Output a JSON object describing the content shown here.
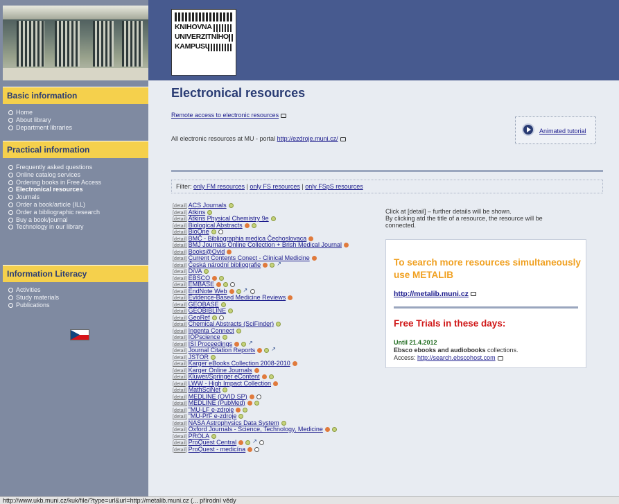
{
  "logo": {
    "line1": "KNIHOVNA",
    "line2": "UNIVERZITNÍHO",
    "line3": "KAMPUSU"
  },
  "sidebar": {
    "sections": [
      {
        "title": "Basic information",
        "items": [
          "Home",
          "About library",
          "Department libraries"
        ]
      },
      {
        "title": "Practical information",
        "items": [
          "Frequently asked questions",
          "Online catalog services",
          "Ordering books in Free Access",
          "Electronical resources",
          "Journals",
          "Order a book/article (ILL)",
          "Order a bibliographic research",
          "Buy a book/journal",
          "Technology in our library"
        ]
      },
      {
        "title": "Information Literacy",
        "items": [
          "Activities",
          "Study materials",
          "Publications"
        ]
      }
    ]
  },
  "main": {
    "title": "Electronical resources",
    "remote_link": "Remote access to electronic resources",
    "all_text": "All electronic resources at MU - portal ",
    "all_link": "http://ezdroje.muni.cz/",
    "tutorial": "Animated tutorial",
    "filter_label": "Filter: ",
    "filters": [
      "only FM resources",
      "only FS resources",
      "only FSpS resources"
    ],
    "filter_sep": " | ",
    "detail_label": "[detail]",
    "note_line1": "Click at [detail] – further details will be shown.",
    "note_line2": "By clicking atd the title of a resource, the resource will be connected.",
    "metalib_heading": "To search more resources simultaneously use METALIB",
    "metalib_link": "http://metalib.muni.cz",
    "trials_heading": "Free Trials in these days:",
    "until": "Until 21.4.2012",
    "ebsco_bold": "Ebsco ebooks and audiobooks",
    "ebsco_rest": " collections.",
    "access_label": "Access: ",
    "access_link": "http://search.ebscohost.com"
  },
  "resources": [
    {
      "name": "ACS Journals",
      "icons": [
        "y"
      ]
    },
    {
      "name": "Atkins",
      "icons": [
        "y"
      ]
    },
    {
      "name": "Atkins Physical Chemistry 9e",
      "icons": [
        "y"
      ]
    },
    {
      "name": "Biological Abstracts",
      "icons": [
        "s",
        "y"
      ]
    },
    {
      "name": "BioOne",
      "icons": [
        "y",
        "c"
      ]
    },
    {
      "name": "BMČ - Bibliographia medica Čechoslovaca",
      "icons": [
        "s"
      ]
    },
    {
      "name": "BMJ Journals Online Collection + Brish Medical Journal",
      "icons": [
        "s"
      ]
    },
    {
      "name": "Books@Ovid",
      "icons": [
        "s"
      ]
    },
    {
      "name": "Current Contents Conect - Clinical Medicine",
      "icons": [
        "s"
      ]
    },
    {
      "name": "Česká národní bibliografie",
      "icons": [
        "s",
        "y",
        "a"
      ]
    },
    {
      "name": "DiVA",
      "icons": [
        "y"
      ]
    },
    {
      "name": "EBSCO",
      "icons": [
        "s",
        "y"
      ]
    },
    {
      "name": "EMBASE",
      "icons": [
        "s",
        "y",
        "c"
      ]
    },
    {
      "name": "EndNote Web",
      "icons": [
        "s",
        "y",
        "a",
        "c"
      ]
    },
    {
      "name": "Evidence-Based Medicine Reviews",
      "icons": [
        "s"
      ]
    },
    {
      "name": "GEOBASE",
      "icons": [
        "y"
      ]
    },
    {
      "name": "GEOBIBLINE",
      "icons": [
        "y"
      ]
    },
    {
      "name": "GeoRef",
      "icons": [
        "y",
        "c"
      ]
    },
    {
      "name": "Chemical Abstracts (SciFinder)",
      "icons": [
        "y"
      ]
    },
    {
      "name": "Ingenta Connect",
      "icons": [
        "y"
      ]
    },
    {
      "name": "IOPscience",
      "icons": [
        "y"
      ]
    },
    {
      "name": "ISI Proceedings",
      "icons": [
        "s",
        "y",
        "a"
      ]
    },
    {
      "name": "Journal Citation Reports",
      "icons": [
        "s",
        "y",
        "a"
      ]
    },
    {
      "name": "JSTOR",
      "icons": [
        "y"
      ]
    },
    {
      "name": "Karger eBooks Collection 2008-2010",
      "icons": [
        "s"
      ]
    },
    {
      "name": "Karger Online Journals",
      "icons": [
        "s"
      ]
    },
    {
      "name": "Kluwer/Springer eContent",
      "icons": [
        "s",
        "y"
      ]
    },
    {
      "name": "LWW - High Impact Collection",
      "icons": [
        "s"
      ]
    },
    {
      "name": "MathSciNet",
      "icons": [
        "y"
      ]
    },
    {
      "name": "MEDLINE (OVID SP)",
      "icons": [
        "s",
        "c"
      ]
    },
    {
      "name": "MEDLINE (PubMed)",
      "icons": [
        "s",
        "y"
      ]
    },
    {
      "name": "\"MU-LF e-zdroje",
      "icons": [
        "s",
        "y"
      ]
    },
    {
      "name": "\"MU-PřF e-zdroje",
      "icons": [
        "y"
      ]
    },
    {
      "name": "NASA Astrophysics Data System",
      "icons": [
        "y"
      ]
    },
    {
      "name": "Oxford Journals - Science, Technology, Medicine",
      "icons": [
        "s",
        "y"
      ]
    },
    {
      "name": "PROLA",
      "icons": [
        "y"
      ]
    },
    {
      "name": "ProQuest Central",
      "icons": [
        "s",
        "y",
        "a",
        "c"
      ]
    },
    {
      "name": "ProQuest - medicína",
      "icons": [
        "s",
        "c"
      ]
    }
  ],
  "status_bar": "http://www.ukb.muni.cz/kuk/file/?type=url&url=http://metalib.muni.cz (... přírodní vědy"
}
